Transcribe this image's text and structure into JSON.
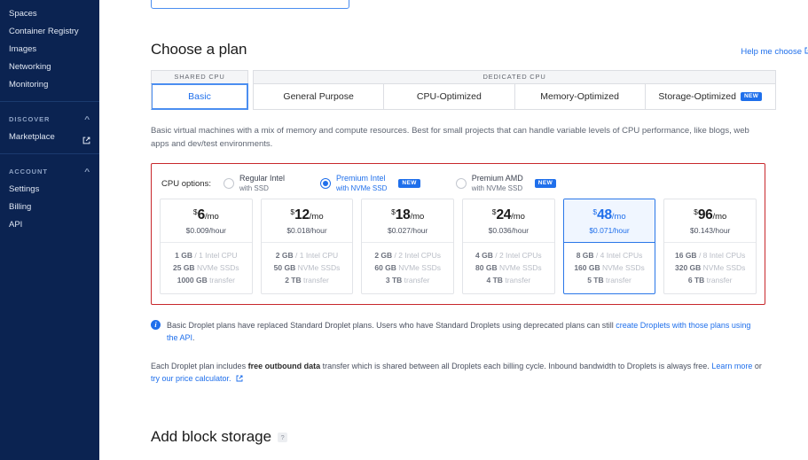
{
  "sidebar": {
    "items": [
      {
        "label": "Spaces",
        "icon": null
      },
      {
        "label": "Container Registry",
        "icon": null
      },
      {
        "label": "Images",
        "icon": null
      },
      {
        "label": "Networking",
        "icon": null
      },
      {
        "label": "Monitoring",
        "icon": null
      }
    ],
    "sections": [
      {
        "label": "DISCOVER",
        "caret": "chevron-up-icon",
        "items": [
          {
            "label": "Marketplace",
            "icon": "external-link-icon"
          }
        ]
      },
      {
        "label": "ACCOUNT",
        "caret": "chevron-up-icon",
        "items": [
          {
            "label": "Settings",
            "icon": null
          },
          {
            "label": "Billing",
            "icon": null
          },
          {
            "label": "API",
            "icon": null
          }
        ]
      }
    ]
  },
  "plan": {
    "title": "Choose a plan",
    "help_link": "Help me choose",
    "help_link_icon": "external-link-icon",
    "shared_group_label": "SHARED CPU",
    "dedicated_group_label": "DEDICATED CPU",
    "shared_tabs": [
      {
        "label": "Basic",
        "selected": true,
        "badge": null
      }
    ],
    "dedicated_tabs": [
      {
        "label": "General Purpose",
        "selected": false,
        "badge": null
      },
      {
        "label": "CPU-Optimized",
        "selected": false,
        "badge": null
      },
      {
        "label": "Memory-Optimized",
        "selected": false,
        "badge": null
      },
      {
        "label": "Storage-Optimized",
        "selected": false,
        "badge": "NEW"
      }
    ],
    "description": "Basic virtual machines with a mix of memory and compute resources. Best for small projects that can handle variable levels of CPU performance, like blogs, web apps and dev/test environments.",
    "cpu_options_label": "CPU options:",
    "cpu_options": [
      {
        "title": "Regular Intel",
        "subtitle": "with SSD",
        "selected": false,
        "badge": null
      },
      {
        "title": "Premium Intel",
        "subtitle": "with NVMe SSD",
        "selected": true,
        "badge": "NEW"
      },
      {
        "title": "Premium AMD",
        "subtitle": "with NVMe SSD",
        "selected": false,
        "badge": "NEW"
      }
    ],
    "cards": [
      {
        "currency": "$",
        "amount": "6",
        "per": "/mo",
        "hourly": "$0.009/hour",
        "memory": "1 GB",
        "cpu": "1 Intel CPU",
        "disk": "25 GB",
        "disk_type": "NVMe SSDs",
        "transfer": "1000 GB",
        "transfer_label": "transfer",
        "selected": false
      },
      {
        "currency": "$",
        "amount": "12",
        "per": "/mo",
        "hourly": "$0.018/hour",
        "memory": "2 GB",
        "cpu": "1 Intel CPU",
        "disk": "50 GB",
        "disk_type": "NVMe SSDs",
        "transfer": "2 TB",
        "transfer_label": "transfer",
        "selected": false
      },
      {
        "currency": "$",
        "amount": "18",
        "per": "/mo",
        "hourly": "$0.027/hour",
        "memory": "2 GB",
        "cpu": "2 Intel CPUs",
        "disk": "60 GB",
        "disk_type": "NVMe SSDs",
        "transfer": "3 TB",
        "transfer_label": "transfer",
        "selected": false
      },
      {
        "currency": "$",
        "amount": "24",
        "per": "/mo",
        "hourly": "$0.036/hour",
        "memory": "4 GB",
        "cpu": "2 Intel CPUs",
        "disk": "80 GB",
        "disk_type": "NVMe SSDs",
        "transfer": "4 TB",
        "transfer_label": "transfer",
        "selected": false
      },
      {
        "currency": "$",
        "amount": "48",
        "per": "/mo",
        "hourly": "$0.071/hour",
        "memory": "8 GB",
        "cpu": "4 Intel CPUs",
        "disk": "160 GB",
        "disk_type": "NVMe SSDs",
        "transfer": "5 TB",
        "transfer_label": "transfer",
        "selected": true
      },
      {
        "currency": "$",
        "amount": "96",
        "per": "/mo",
        "hourly": "$0.143/hour",
        "memory": "16 GB",
        "cpu": "8 Intel CPUs",
        "disk": "320 GB",
        "disk_type": "NVMe SSDs",
        "transfer": "6 TB",
        "transfer_label": "transfer",
        "selected": false
      }
    ],
    "notice": {
      "icon": "info-icon",
      "text_before": "Basic Droplet plans have replaced Standard Droplet plans. Users who have Standard Droplets using deprecated plans can still ",
      "link": "create Droplets with those plans using the API",
      "text_after": "."
    },
    "free_note": {
      "t1": "Each Droplet plan includes ",
      "bold": "free outbound data",
      "t2": " transfer which is shared between all Droplets each billing cycle. Inbound bandwidth to Droplets is always free. ",
      "link1": "Learn more",
      "t3": " or ",
      "link2": "try our price calculator.",
      "link2_icon": "external-link-icon"
    }
  },
  "block_storage": {
    "title": "Add block storage",
    "help_badge": "?"
  },
  "colors": {
    "sidebar_bg": "#0b2351",
    "accent": "#1f6feb",
    "highlight_border": "#c8282c",
    "badge_new": "#1f6feb"
  }
}
